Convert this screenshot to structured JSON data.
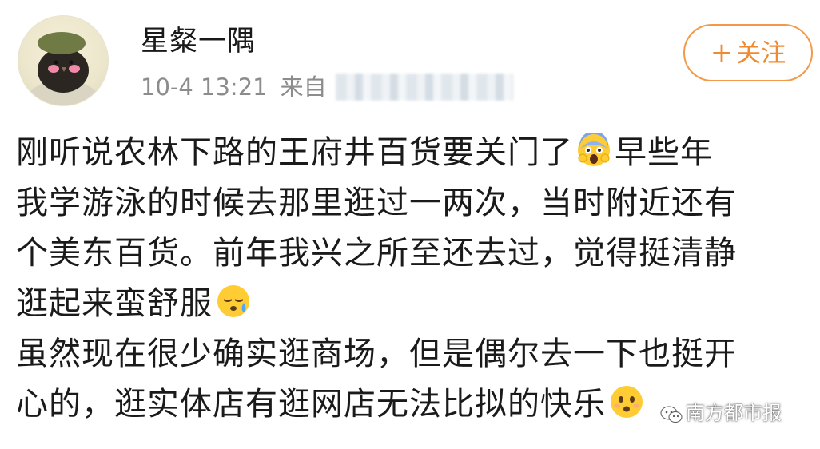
{
  "user": {
    "name": "星粲一隅",
    "post_time": "10-4 13:21",
    "source_label": "来自"
  },
  "follow_button": {
    "plus": "+",
    "label": "关注"
  },
  "post": {
    "line1": "刚听说农林下路的王府井百货要关门了",
    "line1_tail": "早些年",
    "line2": "我学游泳的时候去那里逛过一两次，当时附近还有",
    "line3": "个美东百货。前年我兴之所至还去过，觉得挺清静",
    "line4": "逛起来蛮舒服",
    "line5": "虽然现在很少确实逛商场，但是偶尔去一下也挺开",
    "line6": "心的，逛实体店有逛网店无法比拟的快乐"
  },
  "watermark": {
    "text": "南方都市报"
  },
  "icons": [
    "avatar",
    "fearful-face-emoji",
    "sleepy-sweat-emoji",
    "hushed-face-emoji",
    "wechat-icon"
  ],
  "colors": {
    "accent": "#f08a2f",
    "meta": "#8c8c8c"
  }
}
